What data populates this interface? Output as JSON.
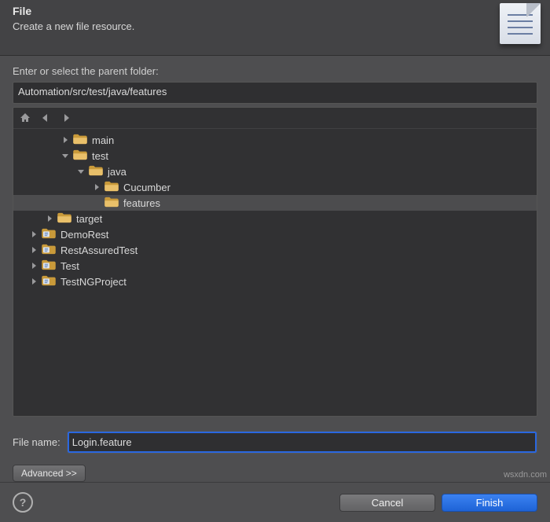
{
  "header": {
    "title": "File",
    "subtitle": "Create a new file resource."
  },
  "parent_label": "Enter or select the parent folder:",
  "path_value": "Automation/src/test/java/features",
  "tree": [
    {
      "depth": 2,
      "arrow": "right",
      "icon": "folder",
      "label": "main",
      "selected": false
    },
    {
      "depth": 2,
      "arrow": "down",
      "icon": "folder",
      "label": "test",
      "selected": false
    },
    {
      "depth": 3,
      "arrow": "down",
      "icon": "folder",
      "label": "java",
      "selected": false
    },
    {
      "depth": 4,
      "arrow": "right",
      "icon": "folder",
      "label": "Cucumber",
      "selected": false
    },
    {
      "depth": 4,
      "arrow": "none",
      "icon": "folder",
      "label": "features",
      "selected": true
    },
    {
      "depth": 1,
      "arrow": "right",
      "icon": "folder",
      "label": "target",
      "selected": false
    },
    {
      "depth": 0,
      "arrow": "right",
      "icon": "project",
      "label": "DemoRest",
      "selected": false
    },
    {
      "depth": 0,
      "arrow": "right",
      "icon": "project",
      "label": "RestAssuredTest",
      "selected": false
    },
    {
      "depth": 0,
      "arrow": "right",
      "icon": "project",
      "label": "Test",
      "selected": false
    },
    {
      "depth": 0,
      "arrow": "right",
      "icon": "project",
      "label": "TestNGProject",
      "selected": false
    }
  ],
  "file_name_label": "File name:",
  "file_name_value": "Login.feature",
  "advanced_label": "Advanced >>",
  "buttons": {
    "cancel": "Cancel",
    "finish": "Finish"
  },
  "watermark": "wsxdn.com"
}
